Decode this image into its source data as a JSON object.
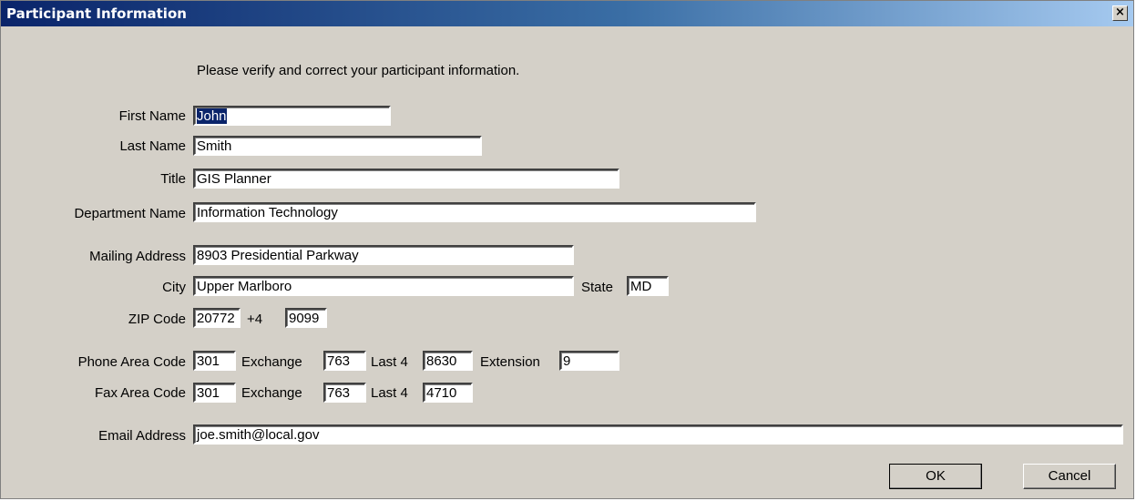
{
  "window": {
    "title": "Participant Information",
    "close_glyph": "×"
  },
  "intro": "Please verify and correct your participant information.",
  "fields": {
    "first_name": {
      "label": "First Name",
      "value": "John"
    },
    "last_name": {
      "label": "Last Name",
      "value": "Smith"
    },
    "title": {
      "label": "Title",
      "value": "GIS Planner"
    },
    "department": {
      "label": "Department Name",
      "value": "Information Technology"
    },
    "mailing_address": {
      "label": "Mailing Address",
      "value": "8903 Presidential Parkway"
    },
    "city": {
      "label": "City",
      "value": "Upper Marlboro"
    },
    "state": {
      "label": "State",
      "value": "MD"
    },
    "zip": {
      "label": "ZIP Code",
      "value": "20772"
    },
    "zip4": {
      "label": "+4",
      "value": "9099"
    },
    "phone_area": {
      "label": "Phone Area Code",
      "value": "301"
    },
    "phone_exchange": {
      "label": "Exchange",
      "value": "763"
    },
    "phone_last4": {
      "label": "Last 4",
      "value": "8630"
    },
    "phone_ext": {
      "label": "Extension",
      "value": "9"
    },
    "fax_area": {
      "label": "Fax Area Code",
      "value": "301"
    },
    "fax_exchange": {
      "label": "Exchange",
      "value": "763"
    },
    "fax_last4": {
      "label": "Last 4",
      "value": "4710"
    },
    "email": {
      "label": "Email Address",
      "value": "joe.smith@local.gov"
    }
  },
  "buttons": {
    "ok": "OK",
    "cancel": "Cancel"
  }
}
